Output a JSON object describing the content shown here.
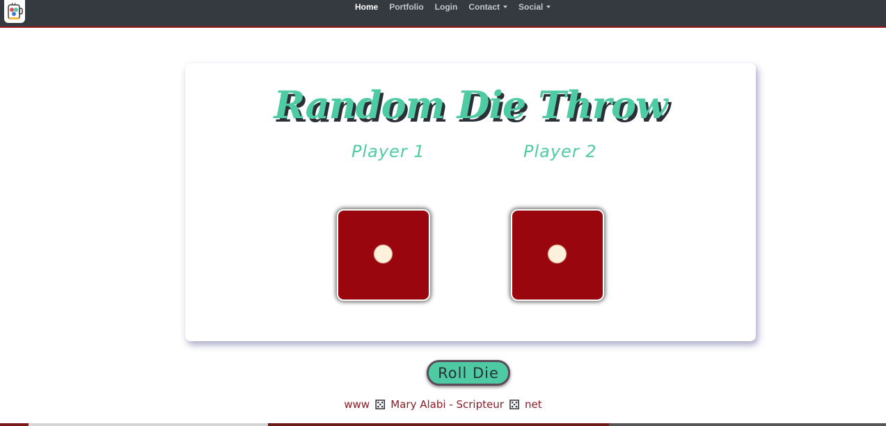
{
  "navbar": {
    "logo_icon": "app-logo-icon",
    "links": [
      {
        "label": "Home",
        "active": true,
        "dropdown": false
      },
      {
        "label": "Portfolio",
        "active": false,
        "dropdown": false
      },
      {
        "label": "Login",
        "active": false,
        "dropdown": false
      },
      {
        "label": "Contact",
        "active": false,
        "dropdown": true
      },
      {
        "label": "Social",
        "active": false,
        "dropdown": true
      }
    ]
  },
  "card": {
    "title": "Random Die Throw",
    "players": [
      {
        "label": "Player 1",
        "die_value": 1
      },
      {
        "label": "Player 2",
        "die_value": 1
      }
    ]
  },
  "roll_button": {
    "label": "Roll Die"
  },
  "footer": {
    "prefix": "www",
    "middle": "Mary Alabi - Scripteur",
    "suffix": "net",
    "separator_icon": "die-icon"
  },
  "colors": {
    "navbar_bg": "#343a40",
    "navbar_border": "#9b1b1b",
    "accent_teal": "#4ecba3",
    "title_shadow": "#2b2f38",
    "die_red": "#9a060e",
    "pip_cream": "#fdf1dc",
    "footer_text": "#8b1a22"
  }
}
